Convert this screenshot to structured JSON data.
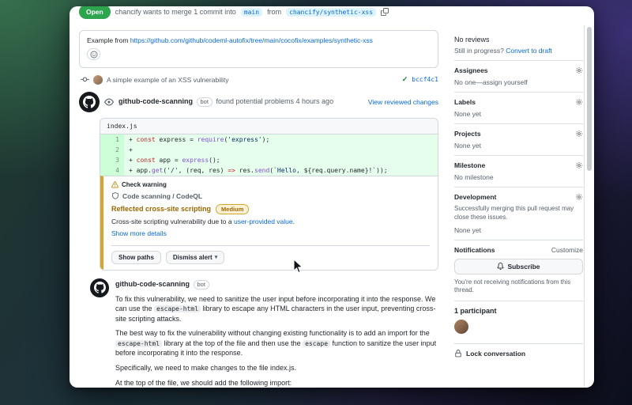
{
  "header": {
    "status_badge": "Open",
    "merge_text": "chancify wants to merge 1 commit into",
    "base_branch": "main",
    "from_text": "from",
    "head_branch": "chancify/synthetic-xss"
  },
  "timeline": {
    "description": {
      "prefix": "Example from ",
      "link": "https://github.com/github/codeml-autofix/tree/main/cocofix/examples/synthetic-xss"
    },
    "commit": {
      "message": "A simple example of an XSS vulnerability",
      "sha": "bccf4c1"
    },
    "review": {
      "author": "github-code-scanning",
      "bot": "bot",
      "action": "found potential problems 4 hours ago",
      "view_changes": "View reviewed changes"
    },
    "file": {
      "name": "index.js",
      "lines": [
        {
          "num": "1",
          "segments": [
            [
              "p",
              "+ "
            ],
            [
              "k",
              "const"
            ],
            [
              "p",
              " express = "
            ],
            [
              "e",
              "require"
            ],
            [
              "p",
              "("
            ],
            [
              "s",
              "'express'"
            ],
            [
              "p",
              ");"
            ]
          ]
        },
        {
          "num": "2",
          "segments": [
            [
              "p",
              "+"
            ]
          ]
        },
        {
          "num": "3",
          "segments": [
            [
              "p",
              "+ "
            ],
            [
              "k",
              "const"
            ],
            [
              "p",
              " app = "
            ],
            [
              "e",
              "express"
            ],
            [
              "p",
              "();"
            ]
          ]
        },
        {
          "num": "4",
          "segments": [
            [
              "p",
              "+ app."
            ],
            [
              "e",
              "get"
            ],
            [
              "p",
              "("
            ],
            [
              "s",
              "'/'"
            ],
            [
              "p",
              ", (req, res) "
            ],
            [
              "k",
              "=>"
            ],
            [
              "p",
              " res."
            ],
            [
              "e",
              "send"
            ],
            [
              "p",
              "("
            ],
            [
              "s",
              "`Hello, "
            ],
            [
              "p",
              "${req.query.name}"
            ],
            [
              "s",
              "!`"
            ],
            [
              "p",
              "));"
            ]
          ]
        }
      ]
    },
    "warning": {
      "header": "Check warning",
      "tool": "Code scanning / CodeQL",
      "title": "Reflected cross-site scripting",
      "severity": "Medium",
      "desc_prefix": "Cross-site scripting vulnerability due to a ",
      "desc_link": "user-provided value",
      "desc_suffix": ".",
      "more": "Show more details",
      "show_paths": "Show paths",
      "dismiss": "Dismiss alert"
    },
    "comment": {
      "author": "github-code-scanning",
      "bot": "bot",
      "paragraphs": [
        [
          [
            "t",
            "To fix this vulnerability, we need to sanitize the user input before incorporating it into the response. We can use the "
          ],
          [
            "c",
            "escape-html"
          ],
          [
            "t",
            " library to escape any HTML characters in the user input, preventing cross-site scripting attacks."
          ]
        ],
        [
          [
            "t",
            "The best way to fix the vulnerability without changing existing functionality is to add an import for the "
          ],
          [
            "c",
            "escape-html"
          ],
          [
            "t",
            " library at the top of the file and then use the "
          ],
          [
            "c",
            "escape"
          ],
          [
            "t",
            " function to sanitize the user input before incorporating it into the response."
          ]
        ],
        [
          [
            "t",
            "Specifically, we need to make changes to the file index.js."
          ]
        ],
        [
          [
            "t",
            "At the top of the file, we should add the following import:"
          ]
        ]
      ]
    }
  },
  "sidebar": {
    "reviews": {
      "title": "No reviews",
      "hint_prefix": "Still in progress? ",
      "hint_link": "Convert to draft"
    },
    "assignees": {
      "title": "Assignees",
      "empty": "No one—assign yourself"
    },
    "labels": {
      "title": "Labels",
      "empty": "None yet"
    },
    "projects": {
      "title": "Projects",
      "empty": "None yet"
    },
    "milestone": {
      "title": "Milestone",
      "empty": "No milestone"
    },
    "development": {
      "title": "Development",
      "note": "Successfully merging this pull request may close these issues.",
      "empty": "None yet"
    },
    "notifications": {
      "title": "Notifications",
      "customize": "Customize",
      "subscribe_label": "Subscribe",
      "note": "You're not receiving notifications from this thread."
    },
    "participants": {
      "title": "1 participant"
    },
    "lock_label": "Lock conversation"
  },
  "colors": {
    "accent": "#0969da",
    "success": "#1a7f37",
    "attention": "#9a6700",
    "open_green": "#2da44e"
  }
}
